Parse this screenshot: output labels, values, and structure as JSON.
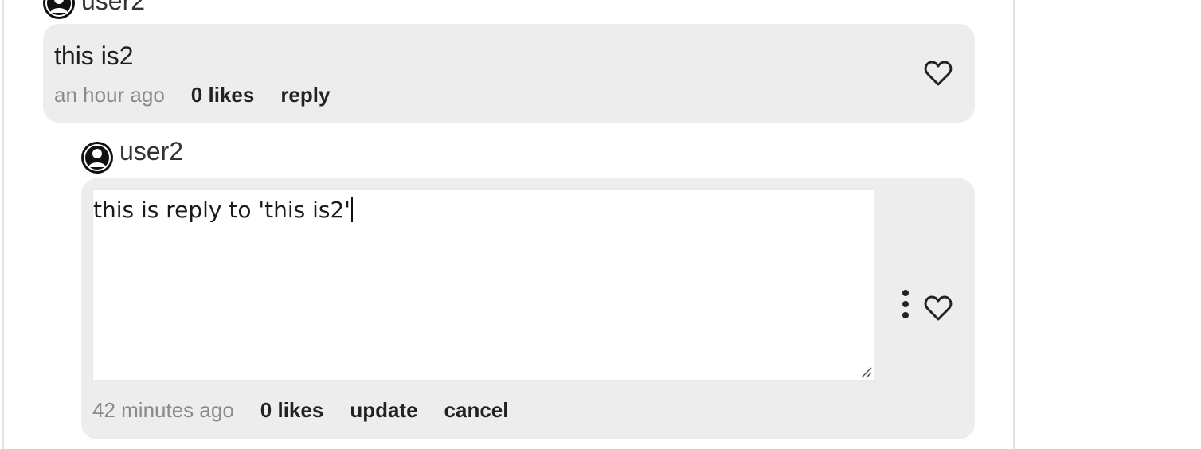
{
  "parent_comment": {
    "username": "user2",
    "text": "this is2",
    "time": "an hour ago",
    "likes": "0 likes",
    "reply_label": "reply",
    "like_icon": "heart-outline-icon"
  },
  "reply_comment": {
    "username": "user2",
    "editor_value": "this is reply to 'this is2'",
    "time": "42 minutes ago",
    "likes": "0 likes",
    "update_label": "update",
    "cancel_label": "cancel",
    "more_icon": "more-vertical-icon",
    "like_icon": "heart-outline-icon"
  },
  "colors": {
    "bubble": "#ededed",
    "timestamp": "#8a8a8a",
    "panel_border": "#e3e3e3"
  }
}
